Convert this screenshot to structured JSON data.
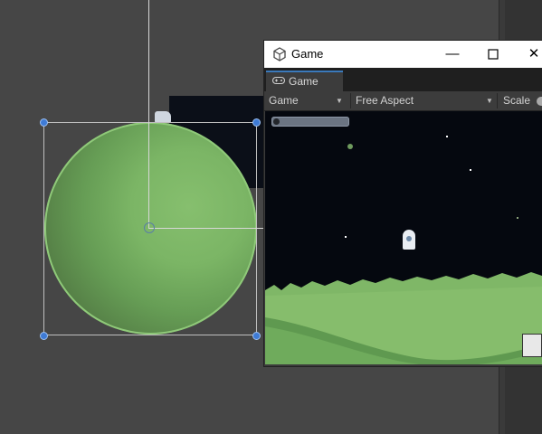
{
  "game_window": {
    "title": "Game",
    "tab_label": "Game",
    "toolbar": {
      "display_dropdown": "Game",
      "aspect_dropdown": "Free Aspect",
      "scale_label": "Scale"
    }
  },
  "icons": {
    "unity_logo": "unity-cube-icon",
    "gamepad": "gamepad-icon",
    "minimize": "minimize-icon",
    "maximize": "maximize-icon",
    "close": "close-icon"
  },
  "colors": {
    "editor_background": "#464646",
    "planet_green": "#7bb565",
    "selection_handle": "#3e7bd6",
    "tab_accent": "#3a79bb"
  }
}
